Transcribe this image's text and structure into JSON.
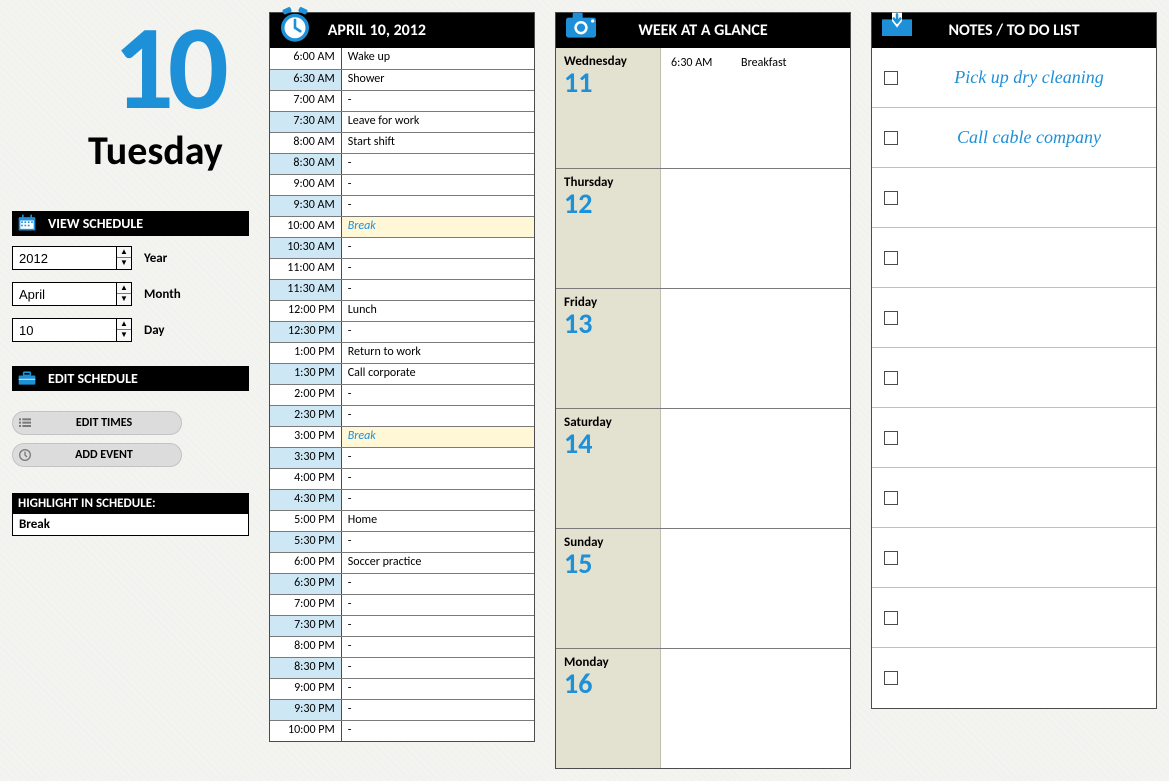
{
  "left": {
    "big_number": "10",
    "day_name": "Tuesday",
    "view_schedule_label": "VIEW SCHEDULE",
    "edit_schedule_label": "EDIT SCHEDULE",
    "year_value": "2012",
    "year_label": "Year",
    "month_value": "April",
    "month_label": "Month",
    "day_value": "10",
    "day_label": "Day",
    "edit_times_label": "EDIT TIMES",
    "add_event_label": "ADD EVENT",
    "highlight_header": "HIGHLIGHT IN SCHEDULE:",
    "highlight_value": "Break"
  },
  "schedule": {
    "title": "APRIL 10, 2012",
    "rows": [
      {
        "time": "6:00 AM",
        "event": "Wake up",
        "alt": false,
        "break": false
      },
      {
        "time": "6:30 AM",
        "event": "Shower",
        "alt": true,
        "break": false
      },
      {
        "time": "7:00 AM",
        "event": "-",
        "alt": false,
        "break": false
      },
      {
        "time": "7:30 AM",
        "event": "Leave for work",
        "alt": true,
        "break": false
      },
      {
        "time": "8:00 AM",
        "event": "Start shift",
        "alt": false,
        "break": false
      },
      {
        "time": "8:30 AM",
        "event": "-",
        "alt": true,
        "break": false
      },
      {
        "time": "9:00 AM",
        "event": "-",
        "alt": false,
        "break": false
      },
      {
        "time": "9:30 AM",
        "event": "-",
        "alt": true,
        "break": false
      },
      {
        "time": "10:00 AM",
        "event": "Break",
        "alt": false,
        "break": true
      },
      {
        "time": "10:30 AM",
        "event": "-",
        "alt": true,
        "break": false
      },
      {
        "time": "11:00 AM",
        "event": "-",
        "alt": false,
        "break": false
      },
      {
        "time": "11:30 AM",
        "event": "-",
        "alt": true,
        "break": false
      },
      {
        "time": "12:00 PM",
        "event": "Lunch",
        "alt": false,
        "break": false
      },
      {
        "time": "12:30 PM",
        "event": "-",
        "alt": true,
        "break": false
      },
      {
        "time": "1:00 PM",
        "event": "Return to work",
        "alt": false,
        "break": false
      },
      {
        "time": "1:30 PM",
        "event": "Call corporate",
        "alt": true,
        "break": false
      },
      {
        "time": "2:00 PM",
        "event": "-",
        "alt": false,
        "break": false
      },
      {
        "time": "2:30 PM",
        "event": "-",
        "alt": true,
        "break": false
      },
      {
        "time": "3:00 PM",
        "event": "Break",
        "alt": false,
        "break": true
      },
      {
        "time": "3:30 PM",
        "event": "-",
        "alt": true,
        "break": false
      },
      {
        "time": "4:00 PM",
        "event": "-",
        "alt": false,
        "break": false
      },
      {
        "time": "4:30 PM",
        "event": "-",
        "alt": true,
        "break": false
      },
      {
        "time": "5:00 PM",
        "event": "Home",
        "alt": false,
        "break": false
      },
      {
        "time": "5:30 PM",
        "event": "-",
        "alt": true,
        "break": false
      },
      {
        "time": "6:00 PM",
        "event": "Soccer practice",
        "alt": false,
        "break": false
      },
      {
        "time": "6:30 PM",
        "event": "-",
        "alt": true,
        "break": false
      },
      {
        "time": "7:00 PM",
        "event": "-",
        "alt": false,
        "break": false
      },
      {
        "time": "7:30 PM",
        "event": "-",
        "alt": true,
        "break": false
      },
      {
        "time": "8:00 PM",
        "event": "-",
        "alt": false,
        "break": false
      },
      {
        "time": "8:30 PM",
        "event": "-",
        "alt": true,
        "break": false
      },
      {
        "time": "9:00 PM",
        "event": "-",
        "alt": false,
        "break": false
      },
      {
        "time": "9:30 PM",
        "event": "-",
        "alt": true,
        "break": false
      },
      {
        "time": "10:00 PM",
        "event": "-",
        "alt": false,
        "break": false
      }
    ]
  },
  "week": {
    "title": "WEEK AT A GLANCE",
    "days": [
      {
        "name": "Wednesday",
        "num": "11",
        "ev_time": "6:30 AM",
        "ev_text": "Breakfast"
      },
      {
        "name": "Thursday",
        "num": "12",
        "ev_time": "",
        "ev_text": ""
      },
      {
        "name": "Friday",
        "num": "13",
        "ev_time": "",
        "ev_text": ""
      },
      {
        "name": "Saturday",
        "num": "14",
        "ev_time": "",
        "ev_text": ""
      },
      {
        "name": "Sunday",
        "num": "15",
        "ev_time": "",
        "ev_text": ""
      },
      {
        "name": "Monday",
        "num": "16",
        "ev_time": "",
        "ev_text": ""
      }
    ]
  },
  "notes": {
    "title": "NOTES / TO DO LIST",
    "items": [
      "Pick up dry cleaning",
      "Call cable company",
      "",
      "",
      "",
      "",
      "",
      "",
      "",
      "",
      ""
    ]
  }
}
